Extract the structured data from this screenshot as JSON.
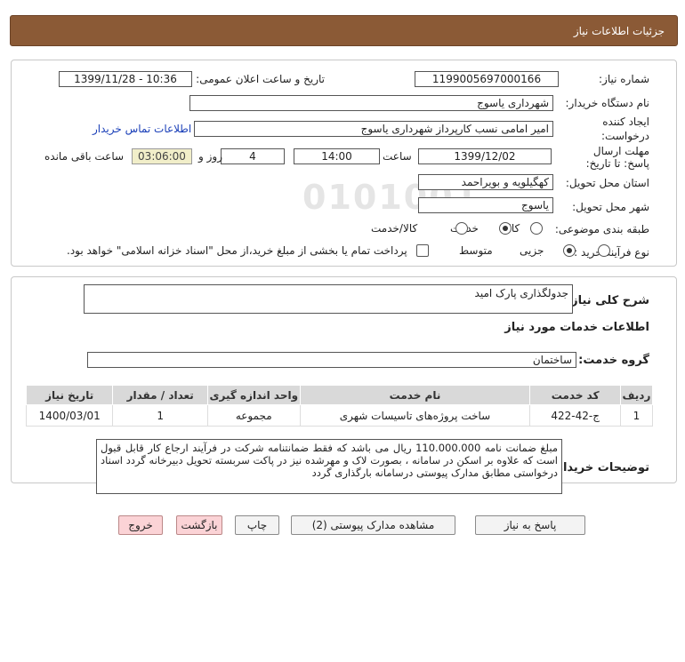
{
  "page": {
    "title": "جزئیات اطلاعات نیاز"
  },
  "form": {
    "need_number_label": "شماره نیاز:",
    "need_number": "1199005697000166",
    "announce_label": "تاریخ و ساعت اعلان عمومی:",
    "announce_value": "1399/11/28 - 10:36",
    "buyer_org_label": "نام دستگاه خریدار:",
    "buyer_org": "شهرداری یاسوج",
    "creator_label": "ایجاد کننده درخواست:",
    "creator": "امیر امامی نسب کارپرداز شهرداری یاسوج",
    "contact_link": "اطلاعات تماس خریدار",
    "deadline_label": "مهلت ارسال پاسخ: تا تاریخ:",
    "deadline_date": "1399/12/02",
    "time_label": "ساعت",
    "deadline_time": "14:00",
    "days_value": "4",
    "days_label": "روز و",
    "remaining_time": "03:06:00",
    "remaining_label": "ساعت باقی مانده",
    "province_label": "استان محل تحویل:",
    "province": "کهگیلویه و بویراحمد",
    "city_label": "شهر محل تحویل:",
    "city": "یاسوج",
    "category_label": "طبقه بندی موضوعی:",
    "category_options": [
      "کالا",
      "خدمت",
      "کالا/خدمت"
    ],
    "category_selected": "خدمت",
    "process_label": "نوع فرآیند خرید :",
    "process_options": [
      "جزیی",
      "متوسط"
    ],
    "process_selected": "متوسط",
    "payment_note": "پرداخت تمام یا بخشی از مبلغ خرید،از محل \"اسناد خزانه اسلامی\" خواهد بود."
  },
  "summary": {
    "label": "شرح کلی نیاز:",
    "value": "جدولگذاری پارک امید",
    "services_heading": "اطلاعات خدمات مورد نیاز",
    "group_label": "گروه خدمت:",
    "group_value": "ساختمان"
  },
  "table": {
    "headers": [
      "ردیف",
      "کد خدمت",
      "نام خدمت",
      "واحد اندازه گیری",
      "تعداد / مقدار",
      "تاریخ نیاز"
    ],
    "rows": [
      [
        "1",
        "ج-42-422",
        "ساخت پروژه‌های تاسیسات شهری",
        "مجموعه",
        "1",
        "1400/03/01"
      ]
    ]
  },
  "buyer_notes": {
    "label": "توضیحات خریدار:",
    "text": "مبلغ ضمانت نامه 110.000.000 ریال می باشد که فقط ضمانتنامه شرکت در فرآیند ارجاع کار قابل قبول است که علاوه بر اسکن در سامانه ، بصورت لاک و مهرشده  نیز در پاکت سربسته تحویل دبیرخانه گردد اسناد درخواستی مطابق مدارک پیوستی درسامانه بارگذاری گردد"
  },
  "buttons": {
    "reply": "پاسخ به نیاز",
    "attachments": "مشاهده مدارک پیوستی (2)",
    "print": "چاپ",
    "back": "بازگشت",
    "exit": "خروج"
  },
  "watermark": {
    "brand": "ParsNamadData",
    "digits": "0101001",
    "tagline": "مرکز فراوری اطلاعات پارس نماد داده"
  },
  "colors": {
    "title_bar": "#8b5a36",
    "remaining_bg": "#f1eec9",
    "pink_button": "#fbd3d6",
    "link": "#1a3fb8"
  }
}
